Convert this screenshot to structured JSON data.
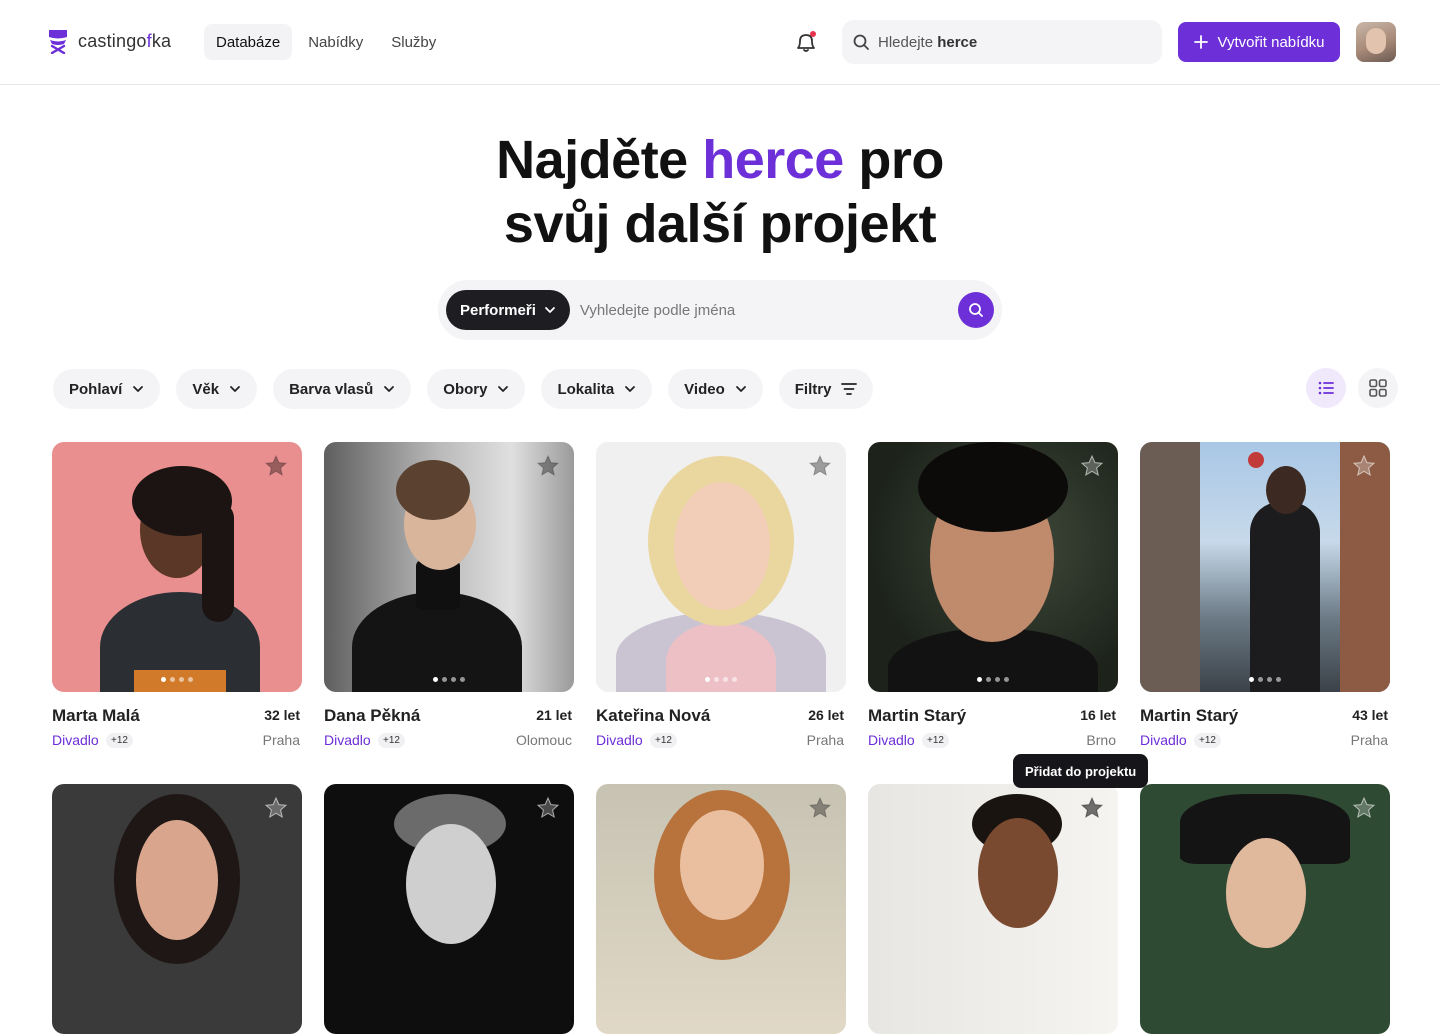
{
  "header": {
    "logo_text_start": "castingo",
    "logo_text_accent": "f",
    "logo_text_end": "ka",
    "nav": [
      {
        "label": "Databáze",
        "active": true
      },
      {
        "label": "Nabídky",
        "active": false
      },
      {
        "label": "Služby",
        "active": false
      }
    ],
    "search_prefix": "Hledejte",
    "search_bold": "herce",
    "create_label": "Vytvořit nabídku"
  },
  "hero": {
    "line1_a": "Najděte",
    "line1_highlight": "herce",
    "line1_b": "pro",
    "line2": "svůj další projekt"
  },
  "main_search": {
    "category": "Performeři",
    "placeholder": "Vyhledejte podle jména"
  },
  "filters": [
    "Pohlaví",
    "Věk",
    "Barva vlasů",
    "Obory",
    "Lokalita",
    "Video",
    "Filtry"
  ],
  "cards": [
    {
      "name": "Marta Malá",
      "age": "32 let",
      "tag": "Divadlo",
      "more": "+12",
      "city": "Praha"
    },
    {
      "name": "Dana Pěkná",
      "age": "21 let",
      "tag": "Divadlo",
      "more": "+12",
      "city": "Olomouc"
    },
    {
      "name": "Kateřina Nová",
      "age": "26 let",
      "tag": "Divadlo",
      "more": "+12",
      "city": "Praha"
    },
    {
      "name": "Martin Starý",
      "age": "16 let",
      "tag": "Divadlo",
      "more": "+12",
      "city": "Brno"
    },
    {
      "name": "Martin Starý",
      "age": "43 let",
      "tag": "Divadlo",
      "more": "+12",
      "city": "Praha"
    }
  ],
  "tooltip": "Přidat do projektu",
  "colors": {
    "accent": "#6c2fd8",
    "dark": "#1e1e22"
  }
}
